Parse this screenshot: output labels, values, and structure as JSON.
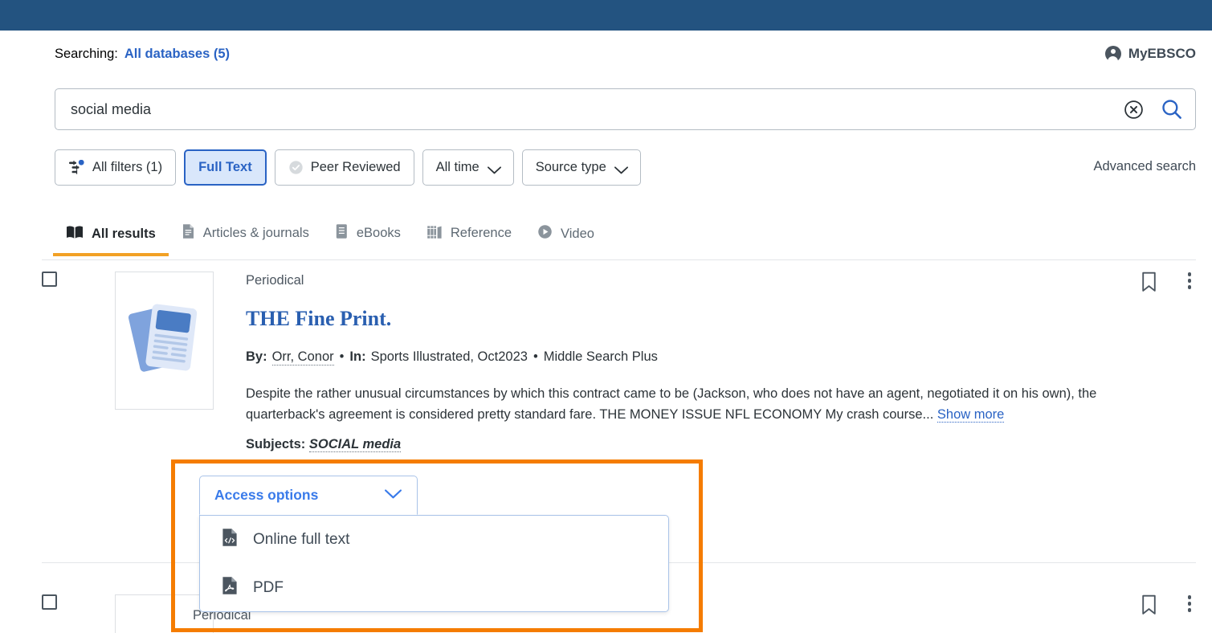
{
  "colors": {
    "banner": "#235380",
    "link_blue": "#2a63c4",
    "accent_orange": "#f2a125",
    "annotation_orange": "#f57c00",
    "title_blue": "#2a5fb0",
    "active_filter_bg": "#d9e7fb"
  },
  "header": {
    "searching_label": "Searching:",
    "database_link": "All databases (5)",
    "account_label": "MyEBSCO",
    "account_icon": "user-circle-icon"
  },
  "search": {
    "value": "social media",
    "placeholder": "",
    "clear_icon": "clear-circle-icon",
    "search_icon": "search-icon"
  },
  "filters": {
    "advanced_search_label": "Advanced search",
    "buttons": [
      {
        "label": "All filters (1)",
        "icon": "filter-sliders-icon",
        "active": false,
        "has_chevron": false
      },
      {
        "label": "Full Text",
        "icon": "",
        "active": true,
        "has_chevron": false
      },
      {
        "label": "Peer Reviewed",
        "icon": "peer-reviewed-badge-icon",
        "active": false,
        "has_chevron": false
      },
      {
        "label": "All time",
        "icon": "",
        "active": false,
        "has_chevron": true
      },
      {
        "label": "Source type",
        "icon": "",
        "active": false,
        "has_chevron": true
      }
    ]
  },
  "tabs": [
    {
      "label": "All results",
      "icon": "open-book-icon",
      "active": true
    },
    {
      "label": "Articles & journals",
      "icon": "article-page-icon",
      "active": false
    },
    {
      "label": "eBooks",
      "icon": "ebook-icon",
      "active": false
    },
    {
      "label": "Reference",
      "icon": "books-shelf-icon",
      "active": false
    },
    {
      "label": "Video",
      "icon": "play-circle-icon",
      "active": false
    }
  ],
  "results": [
    {
      "kind": "Periodical",
      "title": "THE Fine Print.",
      "by_label": "By:",
      "author": "Orr, Conor",
      "in_label": "In:",
      "source": "Sports Illustrated, Oct2023",
      "separator": "•",
      "database": "Middle Search Plus",
      "abstract": "Despite the rather unusual circumstances by which this contract came to be (Jackson, who does not have an agent, negotiated it on his own), the quarterback's agreement is considered pretty standard fare. THE MONEY ISSUE NFL ECONOMY My crash course...",
      "show_more_label": "Show more",
      "subjects_label": "Subjects:",
      "subjects_value": "SOCIAL media",
      "bookmark_icon": "bookmark-icon",
      "menu_icon": "more-options-icon",
      "thumbnail_icon": "periodical-thumbnail-icon"
    },
    {
      "kind": "Periodical",
      "bookmark_icon": "bookmark-icon",
      "menu_icon": "more-options-icon"
    }
  ],
  "access_dropdown": {
    "button_label": "Access options",
    "chevron_icon": "chevron-down-icon",
    "expanded": true,
    "options": [
      {
        "label": "Online full text",
        "icon": "html-document-icon"
      },
      {
        "label": "PDF",
        "icon": "pdf-document-icon"
      }
    ]
  }
}
